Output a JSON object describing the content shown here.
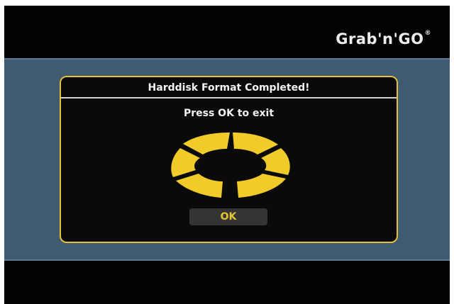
{
  "brand": {
    "logo_text": "Grab'n'GO",
    "logo_mark": "®"
  },
  "dialog": {
    "title": "Harddisk Format Completed!",
    "message": "Press OK to exit",
    "ok_label": "OK",
    "progress_icon": "segmented-ring-spinner-icon"
  },
  "colors": {
    "accent_yellow": "#e3c337",
    "band_blue": "#3f5a71",
    "screen_black": "#030303"
  }
}
